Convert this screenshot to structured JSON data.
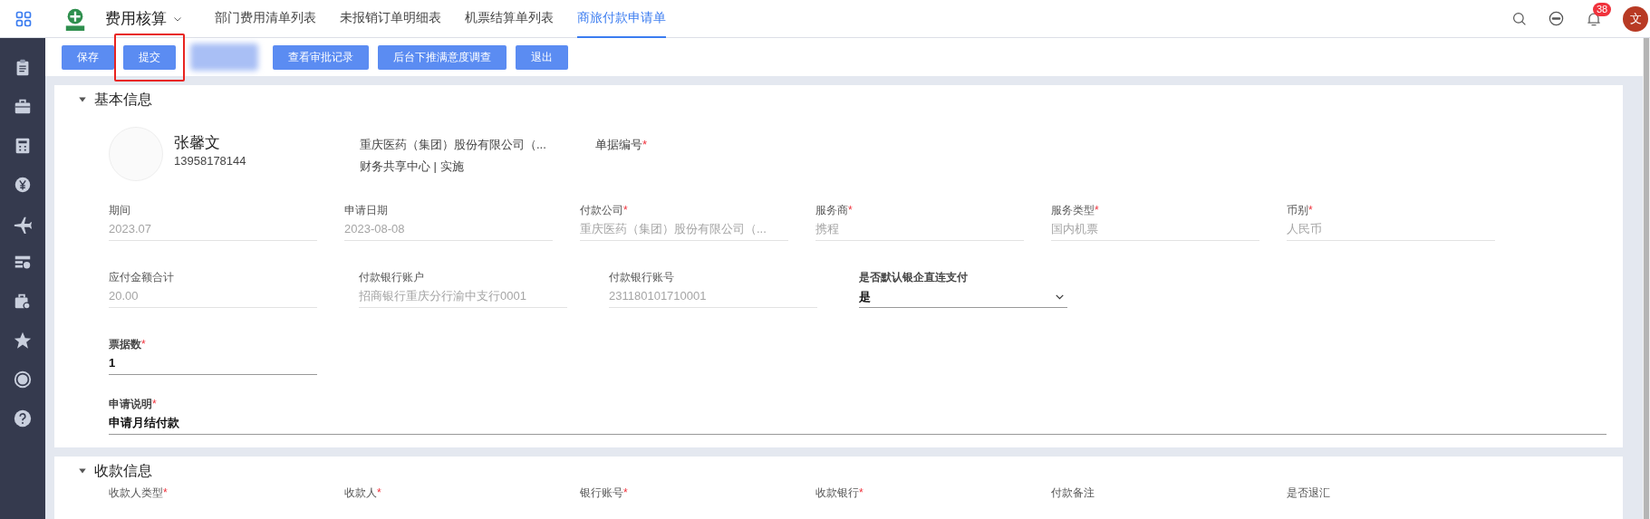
{
  "top_nav": {
    "app_title": "费用核算",
    "tabs": [
      {
        "label": "部门费用清单列表",
        "selected": false
      },
      {
        "label": "未报销订单明细表",
        "selected": false
      },
      {
        "label": "机票结算单列表",
        "selected": false
      },
      {
        "label": "商旅付款申请单",
        "selected": true
      }
    ],
    "notification_count": "38",
    "avatar_text": "文"
  },
  "toolbar": {
    "buttons": [
      {
        "kind": "button",
        "label": "保存",
        "highlighted": false
      },
      {
        "kind": "button",
        "label": "提交",
        "highlighted": true
      },
      {
        "kind": "redacted"
      },
      {
        "kind": "button",
        "label": "查看审批记录",
        "highlighted": false
      },
      {
        "kind": "button",
        "label": "后台下推满意度调查",
        "highlighted": false
      },
      {
        "kind": "button",
        "label": "退出",
        "highlighted": false
      }
    ]
  },
  "sections": [
    {
      "title": "基本信息",
      "expanded": true,
      "profile": {
        "name": "张馨文",
        "phone": "13958178144",
        "company": "重庆医药（集团）股份有限公司（...",
        "department": "财务共享中心 | 实施"
      },
      "doc_number": {
        "label": "单据编号",
        "required_mark": "*"
      },
      "rows": [
        [
          {
            "kind": "readonly",
            "label": "期间",
            "value": "2023.07"
          },
          {
            "kind": "readonly",
            "label": "申请日期",
            "value": "2023-08-08"
          },
          {
            "kind": "readonly",
            "label": "付款公司",
            "required_mark": "*",
            "value": "重庆医药（集团）股份有限公司（..."
          },
          {
            "kind": "readonly",
            "label": "服务商",
            "required_mark": "*",
            "value": "携程"
          },
          {
            "kind": "readonly",
            "label": "服务类型",
            "required_mark": "*",
            "value": "国内机票"
          },
          {
            "kind": "readonly",
            "label": "币别",
            "required_mark": "*",
            "value": "人民币"
          }
        ],
        [
          {
            "kind": "readonly",
            "label": "应付金额合计",
            "value": "20.00"
          },
          {
            "kind": "readonly",
            "label": "付款银行账户",
            "value": "招商银行重庆分行渝中支行0001"
          },
          {
            "kind": "readonly",
            "label": "付款银行账号",
            "value": "231180101710001"
          },
          {
            "kind": "select",
            "label": "是否默认银企直连支付",
            "value": "是"
          }
        ],
        [
          {
            "kind": "input",
            "label": "票据数",
            "required_mark": "*",
            "value": "1"
          }
        ],
        [
          {
            "kind": "text_area",
            "label": "申请说明",
            "required_mark": "*",
            "value": "申请月结付款"
          }
        ]
      ]
    },
    {
      "title": "收款信息",
      "expanded": true,
      "rows": [
        [
          {
            "kind": "label_only",
            "label": "收款人类型",
            "required_mark": "*"
          },
          {
            "kind": "label_only",
            "label": "收款人",
            "required_mark": "*"
          },
          {
            "kind": "label_only",
            "label": "银行账号",
            "required_mark": "*"
          },
          {
            "kind": "label_only",
            "label": "收款银行",
            "required_mark": "*"
          },
          {
            "kind": "label_only",
            "label": "付款备注"
          },
          {
            "kind": "label_only",
            "label": "是否退汇"
          }
        ]
      ]
    }
  ]
}
